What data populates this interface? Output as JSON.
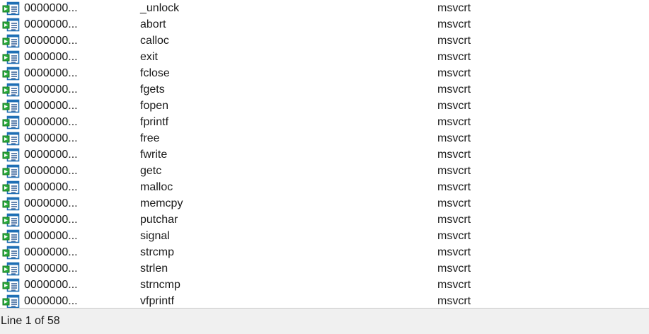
{
  "rows": [
    {
      "address": "0000000...",
      "name": "_unlock",
      "library": "msvcrt",
      "icon": "import-function-icon"
    },
    {
      "address": "0000000...",
      "name": "abort",
      "library": "msvcrt",
      "icon": "import-function-icon"
    },
    {
      "address": "0000000...",
      "name": "calloc",
      "library": "msvcrt",
      "icon": "import-function-icon"
    },
    {
      "address": "0000000...",
      "name": "exit",
      "library": "msvcrt",
      "icon": "import-function-icon"
    },
    {
      "address": "0000000...",
      "name": "fclose",
      "library": "msvcrt",
      "icon": "import-function-icon"
    },
    {
      "address": "0000000...",
      "name": "fgets",
      "library": "msvcrt",
      "icon": "import-function-icon"
    },
    {
      "address": "0000000...",
      "name": "fopen",
      "library": "msvcrt",
      "icon": "import-function-icon"
    },
    {
      "address": "0000000...",
      "name": "fprintf",
      "library": "msvcrt",
      "icon": "import-function-icon"
    },
    {
      "address": "0000000...",
      "name": "free",
      "library": "msvcrt",
      "icon": "import-function-icon"
    },
    {
      "address": "0000000...",
      "name": "fwrite",
      "library": "msvcrt",
      "icon": "import-function-icon"
    },
    {
      "address": "0000000...",
      "name": "getc",
      "library": "msvcrt",
      "icon": "import-function-icon"
    },
    {
      "address": "0000000...",
      "name": "malloc",
      "library": "msvcrt",
      "icon": "import-function-icon"
    },
    {
      "address": "0000000...",
      "name": "memcpy",
      "library": "msvcrt",
      "icon": "import-function-icon"
    },
    {
      "address": "0000000...",
      "name": "putchar",
      "library": "msvcrt",
      "icon": "import-function-icon"
    },
    {
      "address": "0000000...",
      "name": "signal",
      "library": "msvcrt",
      "icon": "import-function-icon"
    },
    {
      "address": "0000000...",
      "name": "strcmp",
      "library": "msvcrt",
      "icon": "import-function-icon"
    },
    {
      "address": "0000000...",
      "name": "strlen",
      "library": "msvcrt",
      "icon": "import-function-icon"
    },
    {
      "address": "0000000...",
      "name": "strncmp",
      "library": "msvcrt",
      "icon": "import-function-icon"
    },
    {
      "address": "0000000...",
      "name": "vfprintf",
      "library": "msvcrt",
      "icon": "import-function-icon"
    }
  ],
  "status": {
    "text": "Line 1 of 58"
  },
  "colors": {
    "icon_border": "#1f6fb5",
    "icon_arrow": "#2aa83c",
    "status_bg": "#f0f0f0"
  }
}
